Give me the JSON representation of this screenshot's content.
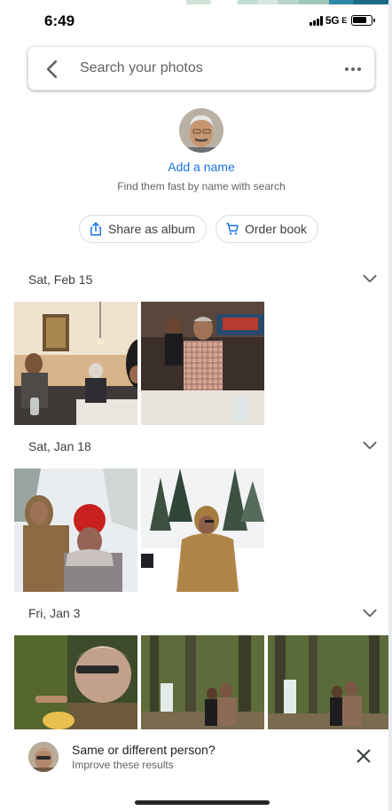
{
  "status": {
    "time": "6:49",
    "network": "5G"
  },
  "search": {
    "placeholder": "Search your photos"
  },
  "person": {
    "add_name": "Add a name",
    "hint": "Find them fast by name with search",
    "share_label": "Share as album",
    "order_label": "Order book"
  },
  "groups": [
    {
      "date": "Sat, Feb 15"
    },
    {
      "date": "Sat, Jan 18"
    },
    {
      "date": "Fri, Jan 3"
    }
  ],
  "suggestion": {
    "title": "Same or different person?",
    "subtitle": "Improve these results"
  },
  "colors": {
    "accent": "#1a73e8",
    "text_secondary": "#5f6368"
  },
  "icons": [
    "back-arrow-icon",
    "more-vert-icon",
    "share-icon",
    "cart-icon",
    "chevron-down-icon",
    "close-icon"
  ]
}
